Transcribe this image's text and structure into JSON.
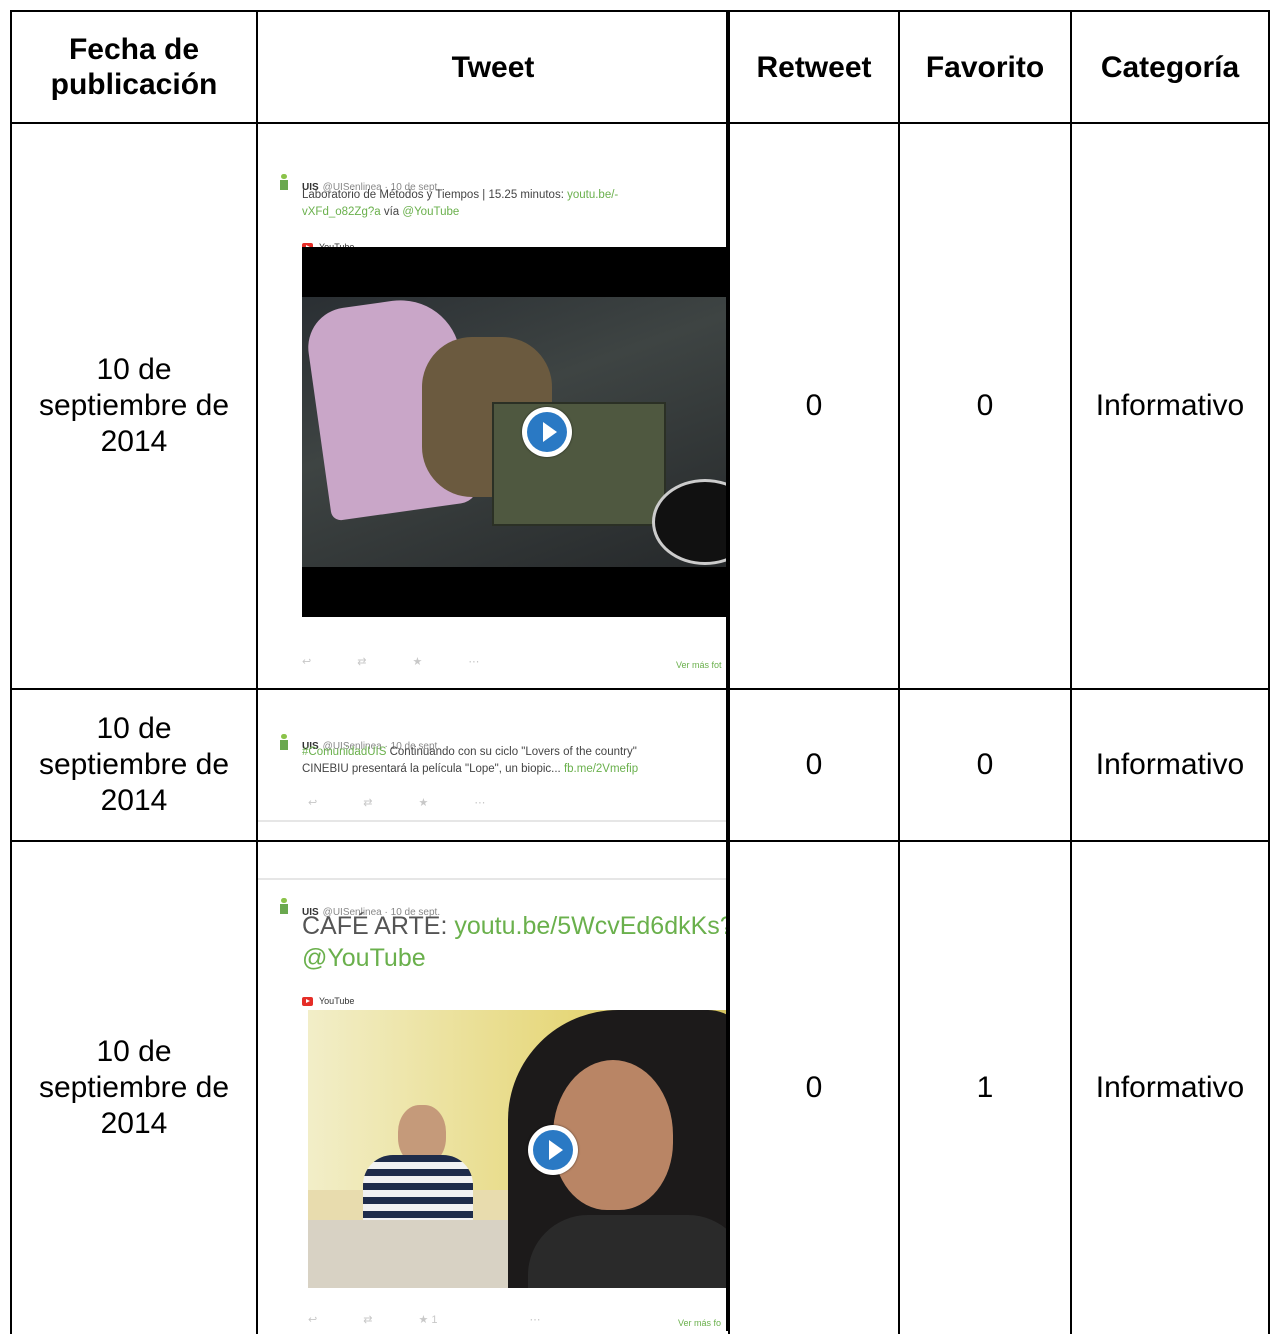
{
  "headers": {
    "date": "Fecha de publicación",
    "tweet": "Tweet",
    "retweet": "Retweet",
    "favorite": "Favorito",
    "category": "Categoría"
  },
  "rows": [
    {
      "date": "10 de septiembre de 2014",
      "retweets": "0",
      "favorites": "0",
      "category": "Informativo",
      "tweet": {
        "account": "UIS",
        "handle": "@UISenlinea · 10 de sept.",
        "text_line1": "Laboratorio de Métodos y Tiempos | 15.25 minutos:",
        "link1": "youtu.be/-",
        "link2": "vXFd_o82Zg?a",
        "via": "vía",
        "mention": "@YouTube",
        "badge": "YouTube",
        "more": "Ver más fot"
      }
    },
    {
      "date": "10 de septiembre de 2014",
      "retweets": "0",
      "favorites": "0",
      "category": "Informativo",
      "tweet": {
        "account": "UIS",
        "handle": "@UISenlinea · 10 de sept.",
        "hashtag": "#ComunidadUIS",
        "text_line1": "Continuando con su ciclo \"Lovers of the country\"",
        "text_line2": "CINEBIU presentará la película \"Lope\", un biopic...",
        "link": "fb.me/2Vmefip"
      }
    },
    {
      "date": "10 de septiembre de 2014",
      "retweets": "0",
      "favorites": "1",
      "category": "Informativo",
      "tweet": {
        "account": "UIS",
        "handle": "@UISenlinea · 10 de sept.",
        "text_start": "CAFÉ ARTE:",
        "link": "youtu.be/5WcvEd6dkKs?",
        "mention": "@YouTube",
        "badge": "YouTube",
        "fav_count": "1",
        "more": "Ver más fo"
      }
    }
  ]
}
